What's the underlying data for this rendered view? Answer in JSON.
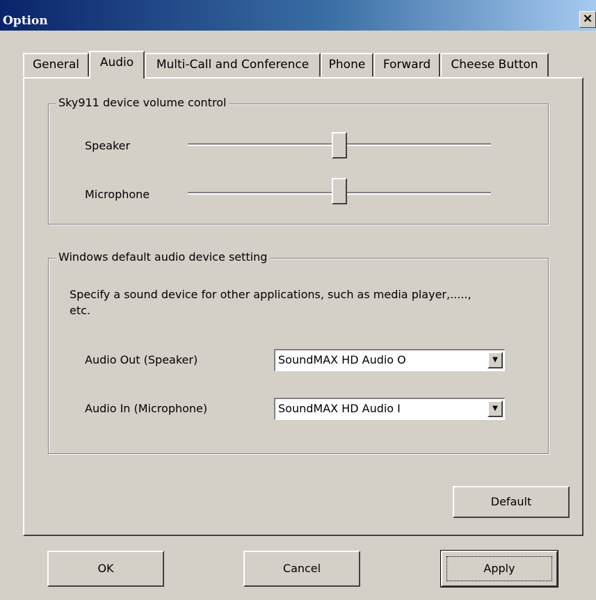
{
  "window": {
    "title": "Option",
    "close_glyph": "×"
  },
  "tabs": [
    {
      "label": "General"
    },
    {
      "label": "Audio"
    },
    {
      "label": "Multi-Call and Conference"
    },
    {
      "label": "Phone"
    },
    {
      "label": "Forward"
    },
    {
      "label": "Cheese Button"
    }
  ],
  "active_tab": "Audio",
  "volume_group": {
    "title": "Sky911 device volume control",
    "speaker_label": "Speaker",
    "microphone_label": "Microphone",
    "speaker_level": 0.5,
    "microphone_level": 0.5
  },
  "audio_device_group": {
    "title": "Windows default audio device setting",
    "description": "Specify a sound device for other applications, such as media player,....., etc.",
    "audio_out_label": "Audio Out (Speaker)",
    "audio_out_value": "SoundMAX HD Audio O",
    "audio_in_label": "Audio In (Microphone)",
    "audio_in_value": "SoundMAX HD Audio I"
  },
  "buttons": {
    "default": "Default",
    "ok": "OK",
    "cancel": "Cancel",
    "apply": "Apply"
  },
  "colors": {
    "title_gradient_start": "#0a246a",
    "title_gradient_end": "#a6caf0",
    "face": "#d4d0c8"
  }
}
